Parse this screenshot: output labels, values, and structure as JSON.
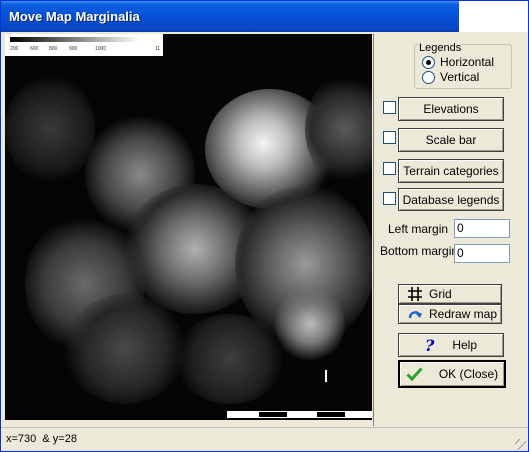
{
  "window": {
    "title": "Move Map Marginalia"
  },
  "map": {
    "elevation_legend_ticks": [
      "200",
      "600",
      "800",
      "900",
      "1000",
      "11"
    ],
    "description_icon": "terrain-map"
  },
  "panel": {
    "legends_group": "Legends",
    "legend_options": [
      {
        "label": "Horizontal",
        "checked": true
      },
      {
        "label": "Vertical",
        "checked": false
      }
    ],
    "buttons": {
      "elevations": "Elevations",
      "scale_bar": "Scale bar",
      "terrain_categories": "Terrain categories",
      "database_legends": "Database legends",
      "grid": "Grid",
      "redraw_map": "Redraw map",
      "help": "Help",
      "ok": "OK (Close)"
    },
    "left_margin": {
      "label": "Left margin",
      "value": "0"
    },
    "bottom_margin": {
      "label": "Bottom margin",
      "value": "0"
    }
  },
  "status": {
    "text": "x=730  & y=28"
  },
  "colors": {
    "title_bar": "#0550d6",
    "dialog_bg": "#ece9d8",
    "ok_check": "#2ea02e",
    "help_icon": "#0000cc",
    "redraw_icon": "#1a5fd6"
  }
}
